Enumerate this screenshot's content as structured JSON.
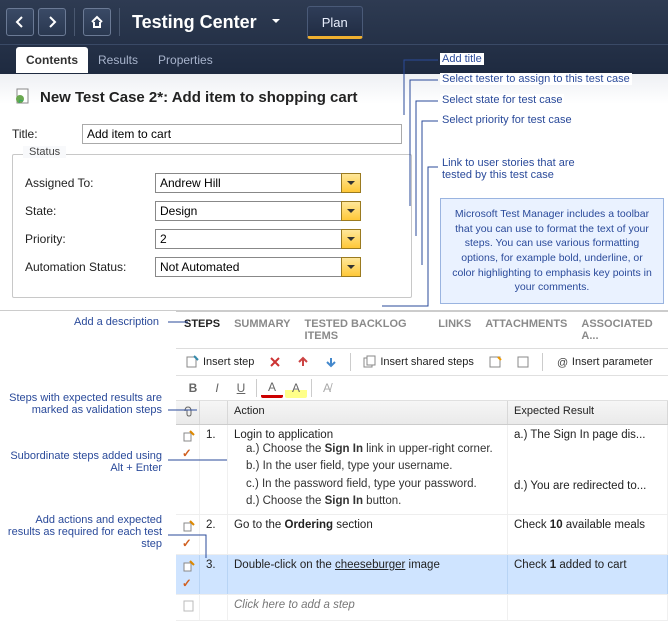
{
  "header": {
    "title": "Testing Center",
    "plan_tab": "Plan"
  },
  "subtabs": {
    "contents": "Contents",
    "results": "Results",
    "properties": "Properties"
  },
  "case": {
    "heading": "New Test Case 2*: Add item to shopping cart",
    "title_label": "Title:",
    "title_value": "Add item to cart"
  },
  "status": {
    "legend": "Status",
    "assigned_label": "Assigned To:",
    "assigned_value": "Andrew Hill",
    "state_label": "State:",
    "state_value": "Design",
    "priority_label": "Priority:",
    "priority_value": "2",
    "auto_label": "Automation Status:",
    "auto_value": "Not Automated"
  },
  "steps_tabs": {
    "steps": "STEPS",
    "summary": "SUMMARY",
    "tested": "TESTED BACKLOG ITEMS",
    "links": "LINKS",
    "attach": "ATTACHMENTS",
    "assoc": "ASSOCIATED A..."
  },
  "toolbar": {
    "insert_step": "Insert step",
    "insert_shared": "Insert shared steps",
    "insert_param": "Insert parameter"
  },
  "grid": {
    "attach_header": "",
    "num_header": "",
    "action_header": "Action",
    "expected_header": "Expected Result",
    "rows": [
      {
        "num": "1.",
        "action_main": "Login to application",
        "subs": [
          "a.) Choose the <b>Sign In</b> link in upper-right corner.",
          "b.) In the user field, type your username.",
          "c.) In the password field, type your password.",
          "d.) Choose the <b>Sign In</b> button."
        ],
        "exp_lines": [
          "a.) The Sign In page dis...",
          "",
          "",
          "d.) You are redirected to..."
        ]
      },
      {
        "num": "2.",
        "action_html": "Go to the <b>Ordering</b> section",
        "exp_html": "Check <b>10</b> available meals"
      },
      {
        "num": "3.",
        "action_html": "Double-click on the <u>cheeseburger</u> image",
        "exp_html": "Check <b>1</b> added to cart",
        "selected": true
      }
    ],
    "placeholder": "Click here to add a step"
  },
  "callouts": {
    "c1": "Add title",
    "c2": "Select tester to assign to this test case",
    "c3": "Select state for test case",
    "c4": "Select priority for test case",
    "c5": "Link to user stories that are tested by this test case",
    "c6": "Add a description",
    "c7": "Steps with expected results are marked as validation steps",
    "c8": "Subordinate steps added using Alt + Enter",
    "c9": "Add actions and expected results as required for each test step",
    "tip": "Microsoft Test Manager includes a toolbar that you can use to format the text of your steps. You can use various formatting options, for example bold, underline, or color highlighting to emphasis key points in your comments."
  }
}
